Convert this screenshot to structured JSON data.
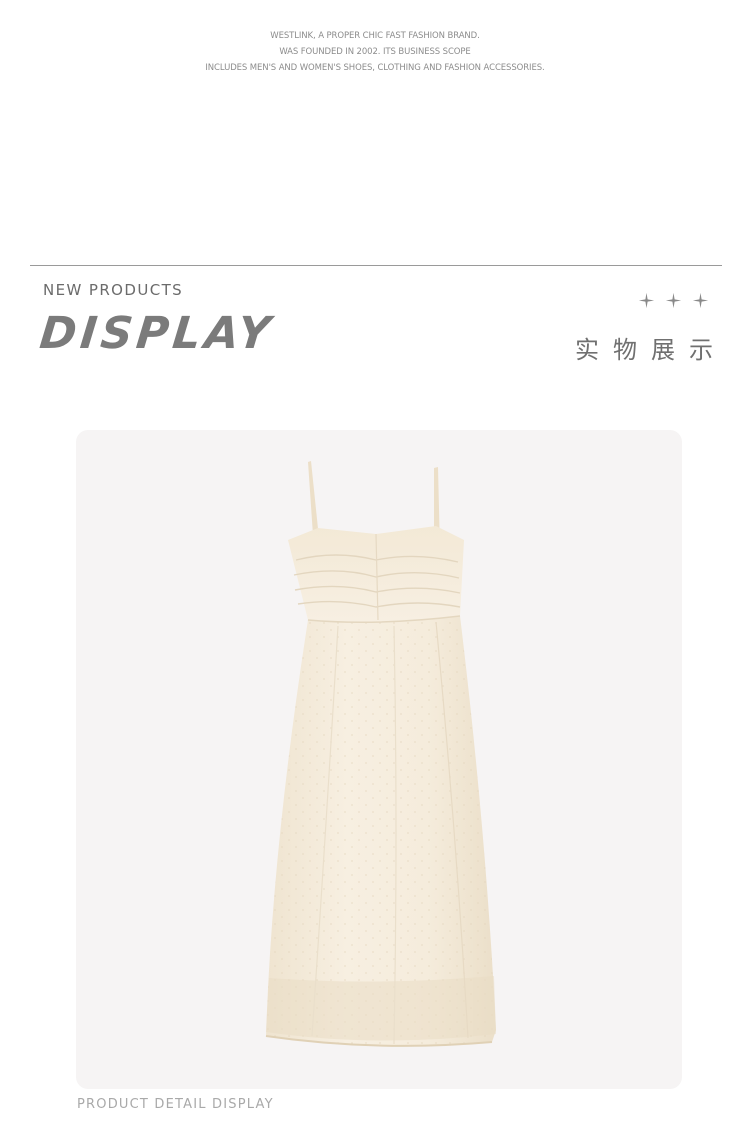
{
  "brand_intro": {
    "lines": [
      "WESTLINK, A PROPER CHIC FAST FASHION BRAND.",
      "WAS FOUNDED IN 2002. ITS BUSINESS SCOPE",
      "INCLUDES MEN'S AND WOMEN'S SHOES, CLOTHING AND FASHION ACCESSORIES."
    ]
  },
  "section": {
    "kicker": "NEW PRODUCTS",
    "title": "DISPLAY",
    "title_cn": "实物展示",
    "decoration_icons": [
      "sparkle-icon",
      "sparkle-icon",
      "sparkle-icon"
    ]
  },
  "product": {
    "image_subject": "dress",
    "caption": "PRODUCT DETAIL DISPLAY"
  },
  "colors": {
    "background": "#ffffff",
    "frame": "#f6f4f4",
    "dress": "#f5ecdc",
    "heading": "#7b7b7b",
    "muted_text": "#a9a9a9"
  }
}
